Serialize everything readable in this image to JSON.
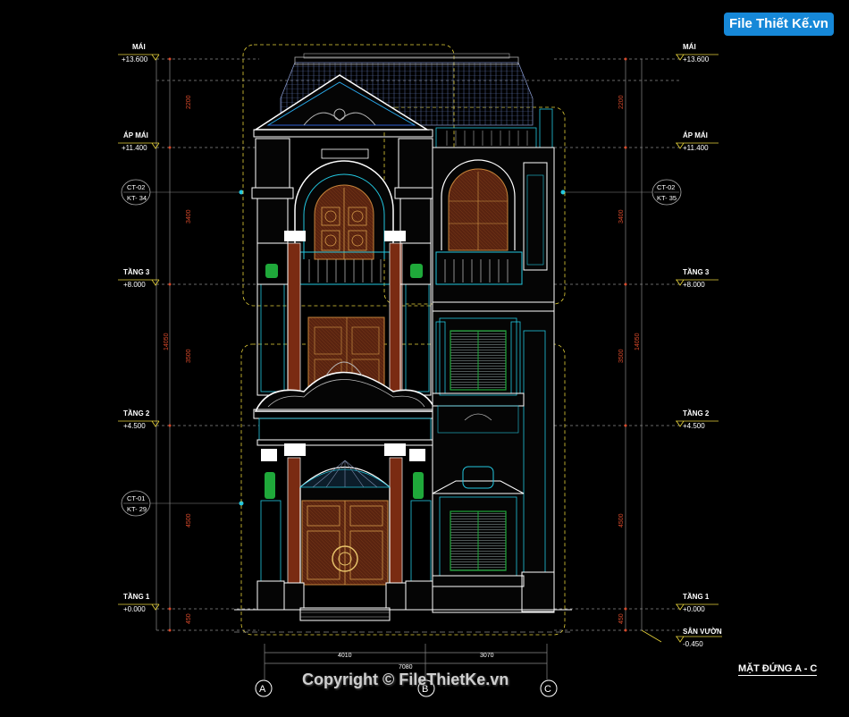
{
  "logo_text": "File Thiết Kế.vn",
  "copyright": "Copyright © FileThietKe.vn",
  "drawing_title": "MẶT ĐỨNG A - C",
  "levels_left": [
    {
      "name": "MÁI",
      "value": "+13.600"
    },
    {
      "name": "ÁP MÁI",
      "value": "+11.400"
    },
    {
      "name": "TẦNG 3",
      "value": "+8.000"
    },
    {
      "name": "TẦNG 2",
      "value": "+4.500"
    },
    {
      "name": "TẦNG 1",
      "value": "+0.000"
    }
  ],
  "levels_right": [
    {
      "name": "MÁI",
      "value": "+13.600"
    },
    {
      "name": "ÁP MÁI",
      "value": "+11.400"
    },
    {
      "name": "TẦNG 3",
      "value": "+8.000"
    },
    {
      "name": "TẦNG 2",
      "value": "+4.500"
    },
    {
      "name": "TẦNG 1",
      "value": "+0.000"
    },
    {
      "name": "SÂN VƯỜN",
      "value": "-0.450"
    }
  ],
  "dims_left": [
    "2200",
    "3400",
    "3500",
    "4500",
    "450"
  ],
  "dims_right": [
    "2200",
    "3400",
    "3500",
    "4500",
    "450"
  ],
  "dim_total_left": "14050",
  "dim_total_right": "14050",
  "callouts": [
    {
      "code": "CT-02",
      "ref": "KT- 34"
    },
    {
      "code": "CT-02",
      "ref": "KT- 35"
    },
    {
      "code": "CT-01",
      "ref": "KT- 29"
    }
  ],
  "bottom_dims": {
    "left": "4010",
    "right": "3070",
    "total": "7080"
  },
  "axes": [
    "A",
    "B",
    "C"
  ],
  "colors": {
    "wood": "#7a2b12",
    "door": "#8a3c18",
    "green": "#1fa83a",
    "cyan": "#22c7e0",
    "yellow": "#e6d23a",
    "white": "#ffffff",
    "dim": "#d94a2b",
    "blue": "#2f5fd0"
  }
}
